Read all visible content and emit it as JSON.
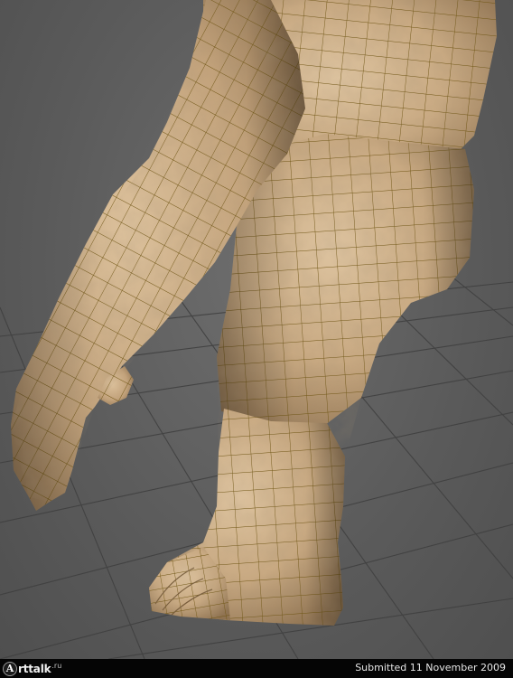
{
  "viewport": {
    "subject": "sculpted leg and arm mesh with wireframe overlay",
    "colors": {
      "background": "#5c5c5c",
      "grid": "#3f3f3f",
      "skin": "#cdb08a",
      "skin_shadow": "#8e7251",
      "wire": "#6e5412"
    }
  },
  "footer": {
    "logo_mark": "A",
    "logo_text": "rttalk",
    "logo_suffix": ".ru",
    "submitted": "Submitted 11 November 2009"
  }
}
